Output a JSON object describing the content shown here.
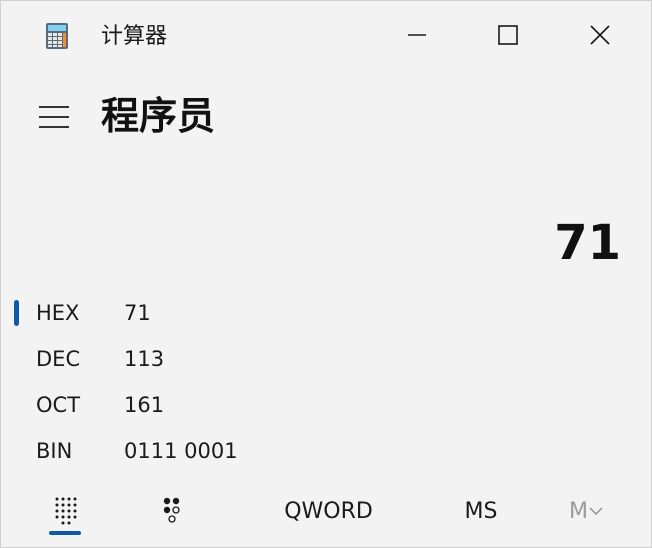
{
  "window": {
    "title": "计算器",
    "app_icon": "calculator-icon",
    "controls": {
      "minimize": "minimize-icon",
      "maximize": "maximize-icon",
      "close": "close-icon"
    }
  },
  "header": {
    "menu_icon": "hamburger-icon",
    "mode_title": "程序员"
  },
  "display": {
    "value": "71"
  },
  "radix": [
    {
      "label": "HEX",
      "value": "71",
      "selected": true
    },
    {
      "label": "DEC",
      "value": "113",
      "selected": false
    },
    {
      "label": "OCT",
      "value": "161",
      "selected": false
    },
    {
      "label": "BIN",
      "value": "0111 0001",
      "selected": false
    }
  ],
  "toolbar": {
    "keypad_icon": "full-keypad-icon",
    "bitflip_icon": "bit-toggling-keypad-icon",
    "word_size": "QWORD",
    "memory_store": "MS",
    "memory_list": "M",
    "memory_list_icon": "chevron-down-icon"
  },
  "colors": {
    "accent": "#0f5aa6",
    "background": "#f3f3f3",
    "disabled_text": "#9a9a9a"
  }
}
